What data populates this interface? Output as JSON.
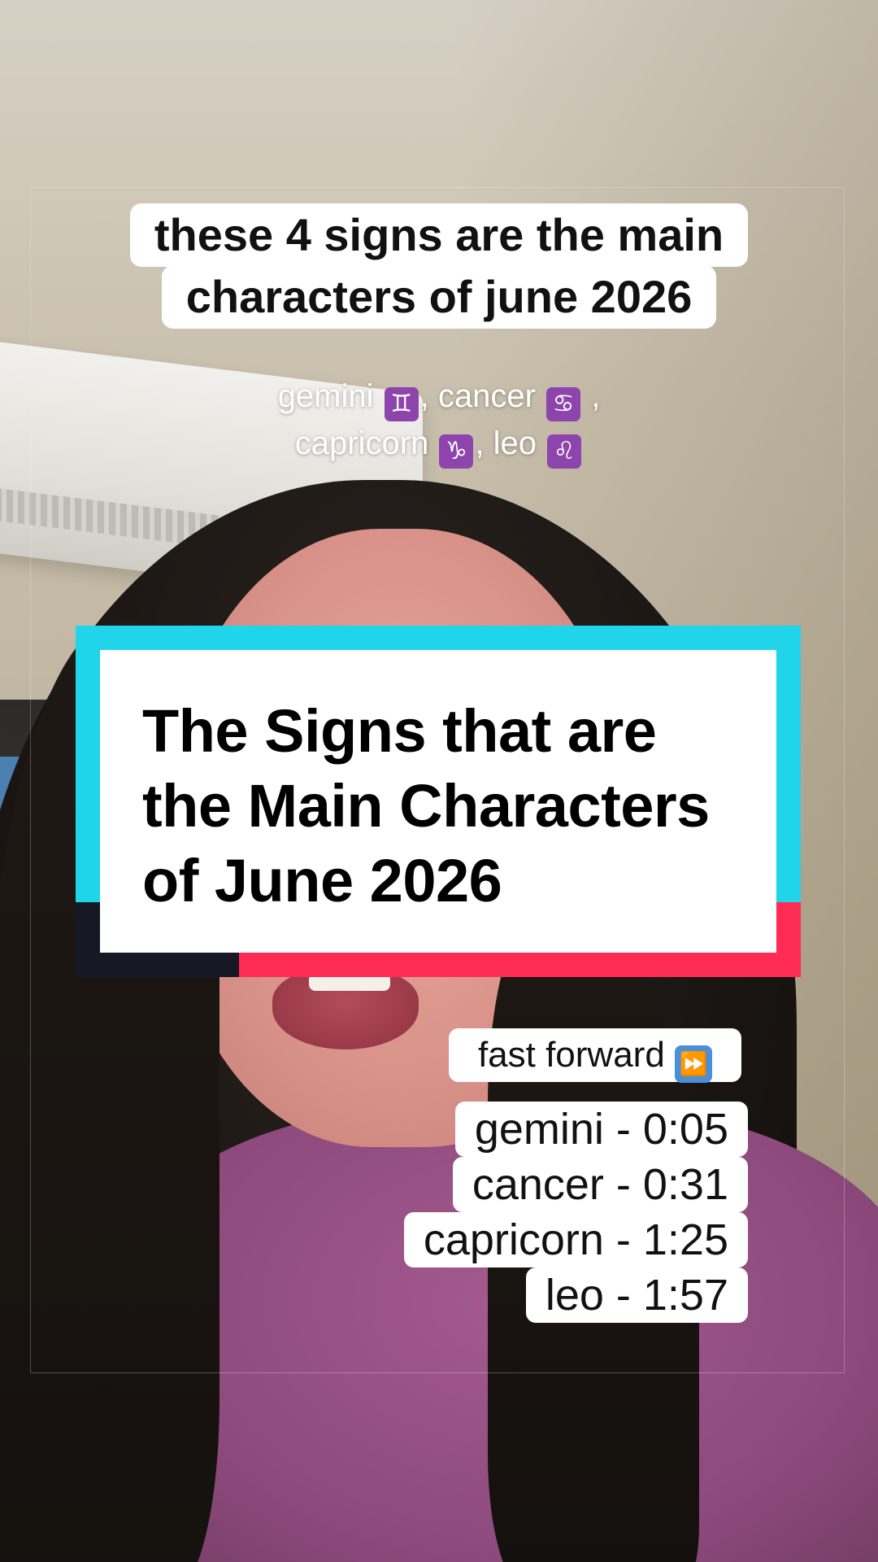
{
  "overlay": {
    "caption_lines": [
      "these 4 signs are the main",
      "characters of june 2026"
    ],
    "signs_line_1": {
      "gemini": "gemini",
      "gemini_symbol": "♊",
      "sep1": ", ",
      "cancer": "cancer",
      "cancer_symbol": "♋",
      "trail": " ,"
    },
    "signs_line_2": {
      "capricorn": "capricorn",
      "capricorn_symbol": "♑",
      "sep": ", ",
      "leo": "leo",
      "leo_symbol": "♌"
    },
    "zodiac_badge_color": "#8e44ad"
  },
  "title_card": {
    "lines": [
      "The Signs that are",
      "the Main Characters",
      "of June 2026"
    ],
    "colors": {
      "cyan": "#20d4ea",
      "red": "#fe2c55",
      "dark": "#161823"
    }
  },
  "fast_forward": {
    "label": "fast forward",
    "icon": "⏩",
    "chapters": [
      "gemini - 0:05",
      "cancer - 0:31",
      "capricorn - 1:25",
      "leo - 1:57"
    ]
  }
}
